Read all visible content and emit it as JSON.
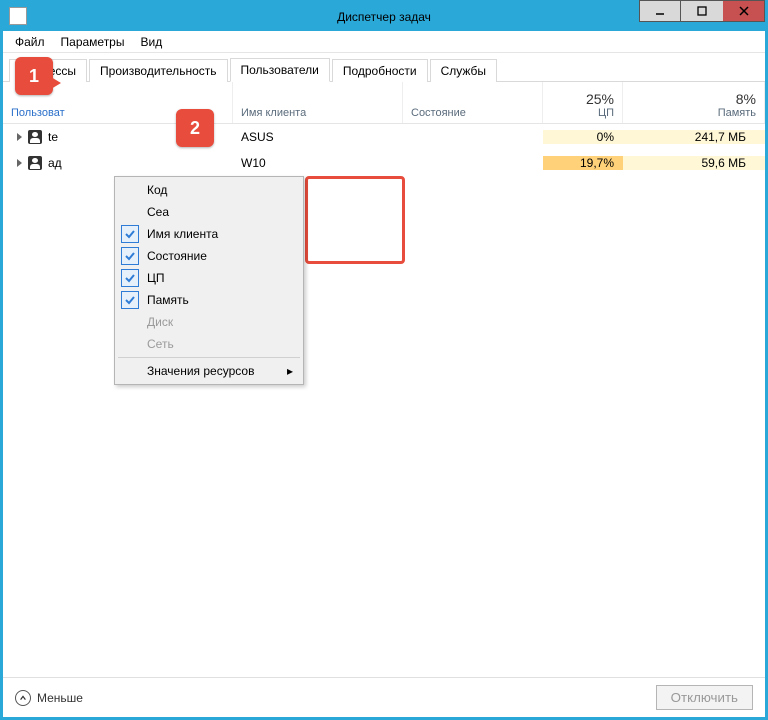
{
  "window": {
    "title": "Диспетчер задач"
  },
  "menubar": {
    "file": "Файл",
    "options": "Параметры",
    "view": "Вид"
  },
  "tabs": {
    "processes": "Процессы",
    "performance": "Производительность",
    "users": "Пользователи",
    "details": "Подробности",
    "services": "Службы"
  },
  "columns": {
    "user": "Пользоват",
    "client": "Имя клиента",
    "status": "Состояние",
    "cpu_pct": "25%",
    "cpu_label": "ЦП",
    "mem_pct": "8%",
    "mem_label": "Память"
  },
  "rows": [
    {
      "user": "te",
      "client": "ASUS",
      "cpu": "0%",
      "mem": "241,7 МБ"
    },
    {
      "user": "ад",
      "client": "W10",
      "cpu": "19,7%",
      "mem": "59,6 МБ"
    }
  ],
  "ctx": {
    "code": "Код",
    "session": "Сеа",
    "client": "Имя клиента",
    "status": "Состояние",
    "cpu": "ЦП",
    "memory": "Память",
    "disk": "Диск",
    "network": "Сеть",
    "resource_values": "Значения ресурсов"
  },
  "footer": {
    "less": "Меньше",
    "disconnect": "Отключить"
  },
  "callouts": {
    "one": "1",
    "two": "2"
  }
}
